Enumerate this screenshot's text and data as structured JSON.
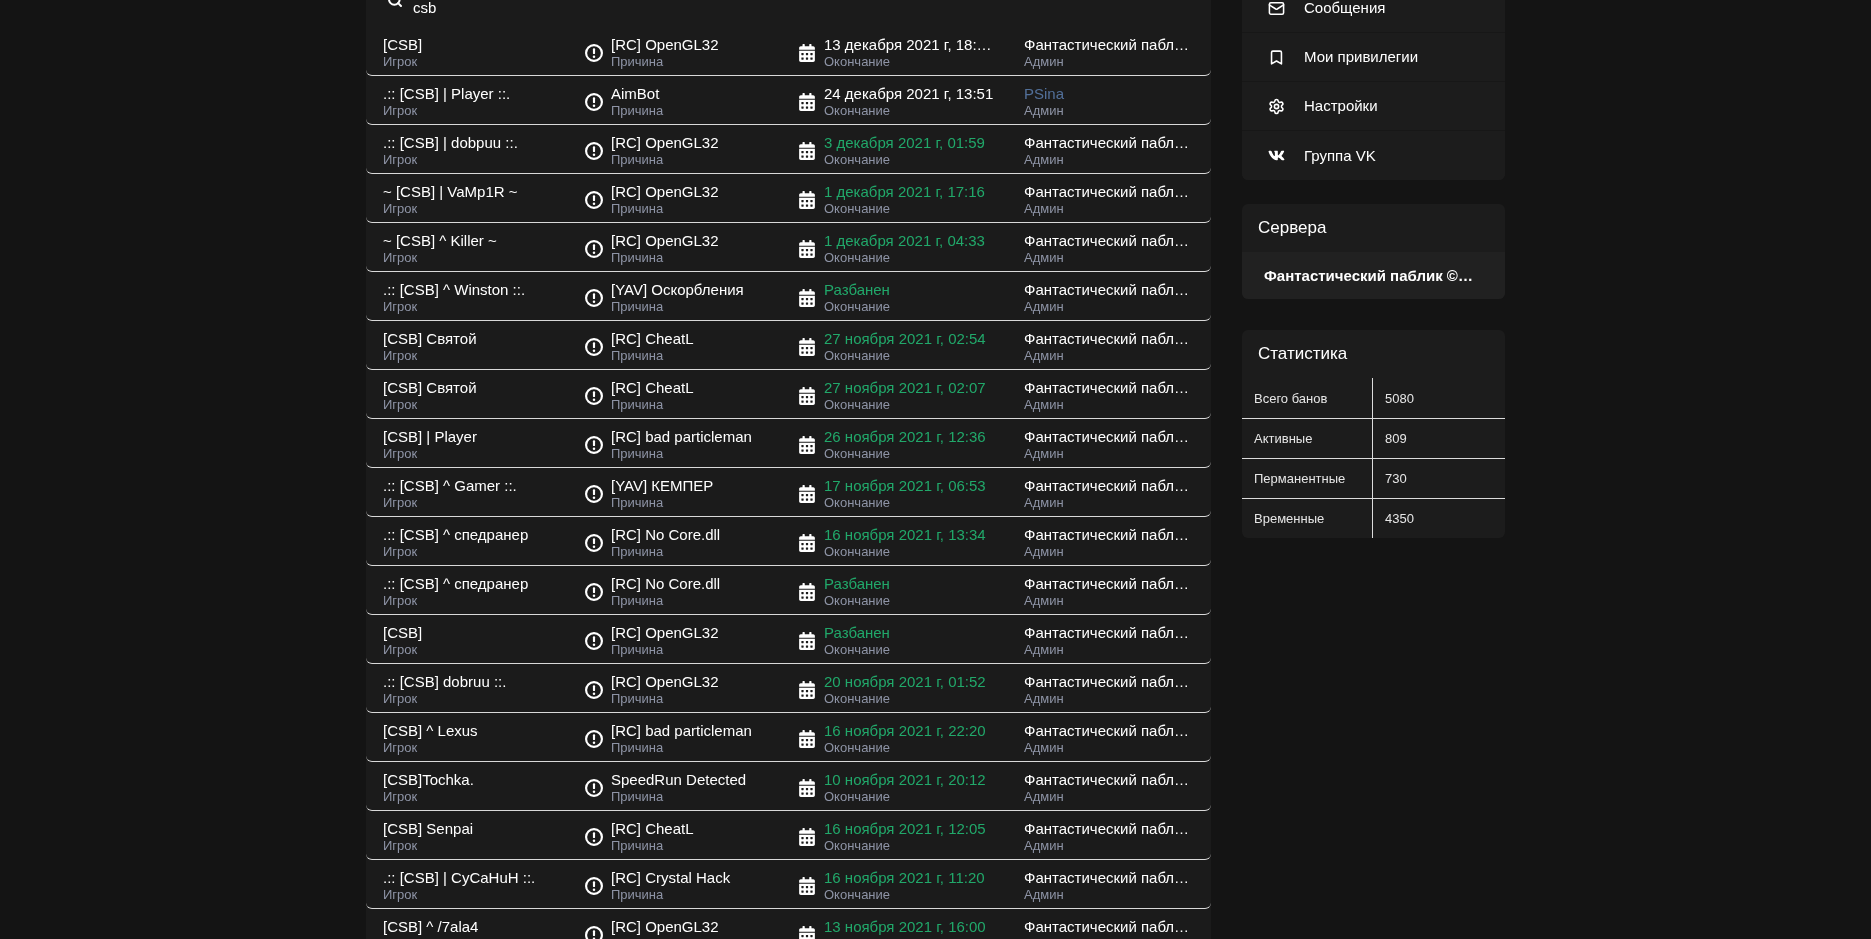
{
  "search": {
    "value": "csb"
  },
  "bans": [
    {
      "player": "[CSB]",
      "player_caption": "Игрок",
      "reason": "[RC] OpenGL32",
      "reason_caption": "Причина",
      "end": "13 декабря 2021 г, 18:…",
      "expired": false,
      "end_caption": "Окончание",
      "admin": "Фантастический пабл…",
      "admin_link": false,
      "admin_caption": "Админ"
    },
    {
      "player": ".:: [CSB] | Player ::.",
      "player_caption": "Игрок",
      "reason": "AimBot",
      "reason_caption": "Причина",
      "end": "24 декабря 2021 г, 13:51",
      "expired": false,
      "end_caption": "Окончание",
      "admin": "PSina",
      "admin_link": true,
      "admin_caption": "Админ"
    },
    {
      "player": ".:: [CSB] | dobpuu ::.",
      "player_caption": "Игрок",
      "reason": "[RC] OpenGL32",
      "reason_caption": "Причина",
      "end": "3 декабря 2021 г, 01:59",
      "expired": true,
      "end_caption": "Окончание",
      "admin": "Фантастический пабл…",
      "admin_link": false,
      "admin_caption": "Админ"
    },
    {
      "player": "~ [CSB] | VaMp1R ~",
      "player_caption": "Игрок",
      "reason": "[RC] OpenGL32",
      "reason_caption": "Причина",
      "end": "1 декабря 2021 г, 17:16",
      "expired": true,
      "end_caption": "Окончание",
      "admin": "Фантастический пабл…",
      "admin_link": false,
      "admin_caption": "Админ"
    },
    {
      "player": "~ [CSB] ^ Killer ~",
      "player_caption": "Игрок",
      "reason": "[RC] OpenGL32",
      "reason_caption": "Причина",
      "end": "1 декабря 2021 г, 04:33",
      "expired": true,
      "end_caption": "Окончание",
      "admin": "Фантастический пабл…",
      "admin_link": false,
      "admin_caption": "Админ"
    },
    {
      "player": ".:: [CSB] ^ Winston ::.",
      "player_caption": "Игрок",
      "reason": "[YAV] Оскорбления",
      "reason_caption": "Причина",
      "end": "Разбанен",
      "expired": true,
      "end_caption": "Окончание",
      "admin": "Фантастический пабл…",
      "admin_link": false,
      "admin_caption": "Админ"
    },
    {
      "player": "[CSB] Святой",
      "player_caption": "Игрок",
      "reason": "[RC] CheatL",
      "reason_caption": "Причина",
      "end": "27 ноября 2021 г, 02:54",
      "expired": true,
      "end_caption": "Окончание",
      "admin": "Фантастический пабл…",
      "admin_link": false,
      "admin_caption": "Админ"
    },
    {
      "player": "[CSB] Святой",
      "player_caption": "Игрок",
      "reason": "[RC] CheatL",
      "reason_caption": "Причина",
      "end": "27 ноября 2021 г, 02:07",
      "expired": true,
      "end_caption": "Окончание",
      "admin": "Фантастический пабл…",
      "admin_link": false,
      "admin_caption": "Админ"
    },
    {
      "player": "[CSB] | Player",
      "player_caption": "Игрок",
      "reason": "[RC] bad particleman",
      "reason_caption": "Причина",
      "end": "26 ноября 2021 г, 12:36",
      "expired": true,
      "end_caption": "Окончание",
      "admin": "Фантастический пабл…",
      "admin_link": false,
      "admin_caption": "Админ"
    },
    {
      "player": ".:: [CSB] ^ Gamer ::.",
      "player_caption": "Игрок",
      "reason": "[YAV] КЕМПЕР",
      "reason_caption": "Причина",
      "end": "17 ноября 2021 г, 06:53",
      "expired": true,
      "end_caption": "Окончание",
      "admin": "Фантастический пабл…",
      "admin_link": false,
      "admin_caption": "Админ"
    },
    {
      "player": ".:: [CSB] ^ спедранер",
      "player_caption": "Игрок",
      "reason": "[RC] No Core.dll",
      "reason_caption": "Причина",
      "end": "16 ноября 2021 г, 13:34",
      "expired": true,
      "end_caption": "Окончание",
      "admin": "Фантастический пабл…",
      "admin_link": false,
      "admin_caption": "Админ"
    },
    {
      "player": ".:: [CSB] ^ спедранер",
      "player_caption": "Игрок",
      "reason": "[RC] No Core.dll",
      "reason_caption": "Причина",
      "end": "Разбанен",
      "expired": true,
      "end_caption": "Окончание",
      "admin": "Фантастический пабл…",
      "admin_link": false,
      "admin_caption": "Админ"
    },
    {
      "player": "[CSB]",
      "player_caption": "Игрок",
      "reason": "[RC] OpenGL32",
      "reason_caption": "Причина",
      "end": "Разбанен",
      "expired": true,
      "end_caption": "Окончание",
      "admin": "Фантастический пабл…",
      "admin_link": false,
      "admin_caption": "Админ"
    },
    {
      "player": ".:: [CSB] dobruu ::.",
      "player_caption": "Игрок",
      "reason": "[RC] OpenGL32",
      "reason_caption": "Причина",
      "end": "20 ноября 2021 г, 01:52",
      "expired": true,
      "end_caption": "Окончание",
      "admin": "Фантастический пабл…",
      "admin_link": false,
      "admin_caption": "Админ"
    },
    {
      "player": "[CSB] ^ Lexus",
      "player_caption": "Игрок",
      "reason": "[RC] bad particleman",
      "reason_caption": "Причина",
      "end": "16 ноября 2021 г, 22:20",
      "expired": true,
      "end_caption": "Окончание",
      "admin": "Фантастический пабл…",
      "admin_link": false,
      "admin_caption": "Админ"
    },
    {
      "player": "[CSB]Tochka.",
      "player_caption": "Игрок",
      "reason": "SpeedRun Detected",
      "reason_caption": "Причина",
      "end": "10 ноября 2021 г, 20:12",
      "expired": true,
      "end_caption": "Окончание",
      "admin": "Фантастический пабл…",
      "admin_link": false,
      "admin_caption": "Админ"
    },
    {
      "player": "[CSB] Senpai",
      "player_caption": "Игрок",
      "reason": "[RC] CheatL",
      "reason_caption": "Причина",
      "end": "16 ноября 2021 г, 12:05",
      "expired": true,
      "end_caption": "Окончание",
      "admin": "Фантастический пабл…",
      "admin_link": false,
      "admin_caption": "Админ"
    },
    {
      "player": ".:: [CSB] | CyCaHuH ::.",
      "player_caption": "Игрок",
      "reason": "[RC] Crystal Hack",
      "reason_caption": "Причина",
      "end": "16 ноября 2021 г, 11:20",
      "expired": true,
      "end_caption": "Окончание",
      "admin": "Фантастический пабл…",
      "admin_link": false,
      "admin_caption": "Админ"
    },
    {
      "player": "[CSB] ^ /7ala4",
      "reason": "[RC] OpenGL32",
      "end": "13 ноября 2021 г, 16:00",
      "expired": true,
      "admin": "Фантастический пабл…",
      "admin_link": false
    }
  ],
  "menu": [
    {
      "kind": "messages",
      "label": "Сообщения"
    },
    {
      "kind": "privileges",
      "label": "Мои привилегии"
    },
    {
      "kind": "settings",
      "label": "Настройки"
    },
    {
      "kind": "vk",
      "label": "Группа VK"
    }
  ],
  "servers": {
    "title": "Сервера",
    "items": [
      "Фантастический паблик ©…"
    ]
  },
  "stats": {
    "title": "Статистика",
    "rows": [
      {
        "label": "Всего банов",
        "value": "5080"
      },
      {
        "label": "Активные",
        "value": "809"
      },
      {
        "label": "Перманентные",
        "value": "730"
      },
      {
        "label": "Временные",
        "value": "4350"
      }
    ]
  }
}
